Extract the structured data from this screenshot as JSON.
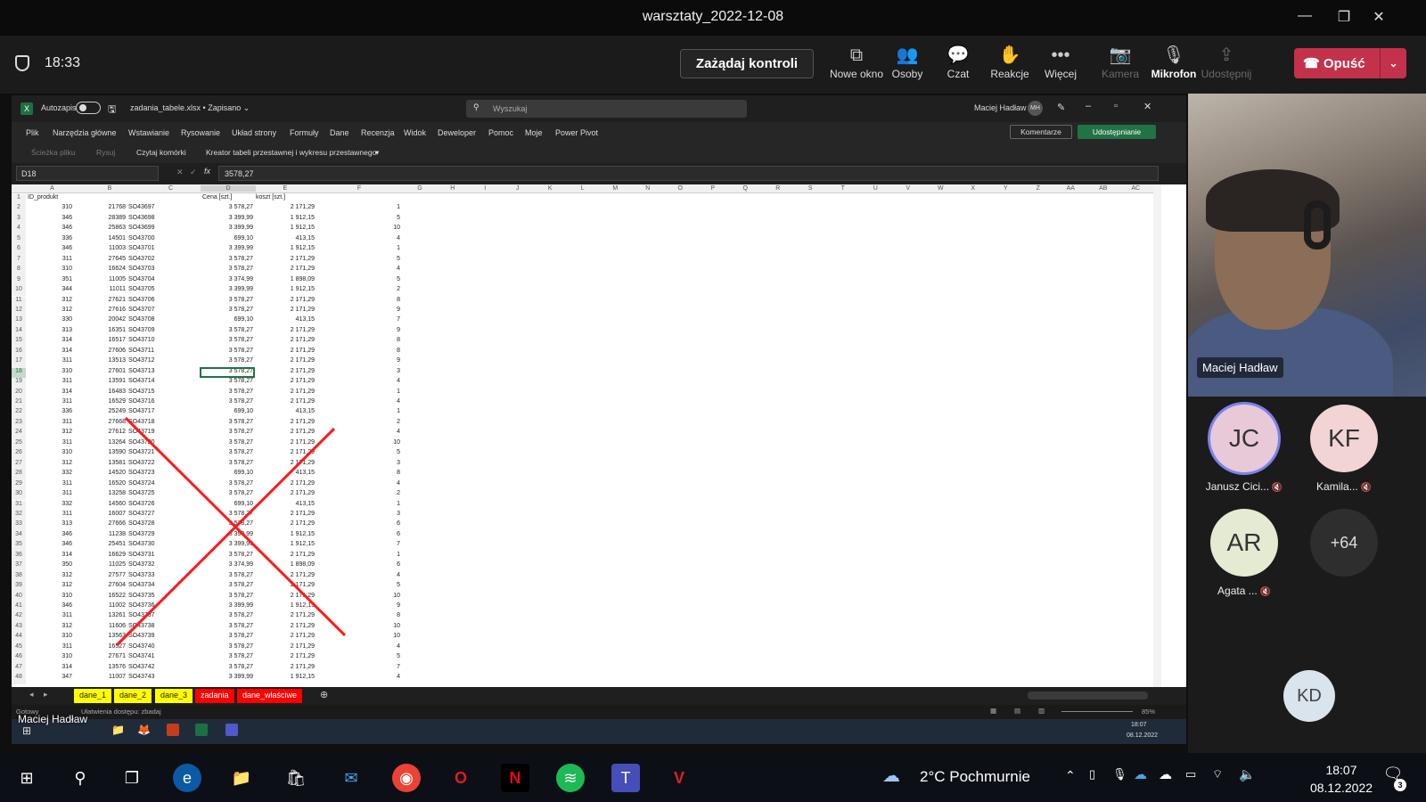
{
  "window": {
    "title": "warsztaty_2022-12-08"
  },
  "meeting": {
    "time": "18:33",
    "request_control": "Zażądaj kontroli",
    "tools": [
      {
        "label": "Nowe okno",
        "icon": "new-window-icon",
        "glyph": "⧉",
        "enabled": true
      },
      {
        "label": "Osoby",
        "icon": "people-icon",
        "glyph": "👥",
        "enabled": true
      },
      {
        "label": "Czat",
        "icon": "chat-icon",
        "glyph": "💬",
        "enabled": true
      },
      {
        "label": "Reakcje",
        "icon": "reactions-icon",
        "glyph": "✋",
        "enabled": true
      },
      {
        "label": "Więcej",
        "icon": "more-icon",
        "glyph": "•••",
        "enabled": true
      },
      {
        "label": "Kamera",
        "icon": "camera-off-icon",
        "glyph": "📷",
        "enabled": false
      },
      {
        "label": "Mikrofon",
        "icon": "mic-off-icon",
        "glyph": "🎙",
        "enabled": true
      },
      {
        "label": "Udostępnij",
        "icon": "share-icon",
        "glyph": "⇪",
        "enabled": false
      }
    ],
    "leave": "Opuść",
    "presenter_name": "Maciej Hadław"
  },
  "excel": {
    "autosave": "Autozapis",
    "filename": "zadania_tabele.xlsx • Zapisano ⌄",
    "search_placeholder": "Wyszukaj",
    "user": "Maciej Hadław",
    "user_initials": "MH",
    "menu": [
      "Plik",
      "Narzędzia główne",
      "Wstawianie",
      "Rysowanie",
      "Układ strony",
      "Formuły",
      "Dane",
      "Recenzja",
      "Widok",
      "Deweloper",
      "Pomoc",
      "Moje",
      "Power Pivot"
    ],
    "comments": "Komentarze",
    "share": "Udostępnianie",
    "toolbar": [
      "Ścieżka pliku",
      "Rysuj",
      "Czytaj komórki",
      "Kreator tabeli przestawnej i wykresu przestawnego"
    ],
    "namebox": "D18",
    "formula": "3578,27",
    "columns": [
      "A",
      "B",
      "C",
      "D",
      "E",
      "F",
      "G",
      "H",
      "I",
      "J",
      "K",
      "L",
      "M",
      "N",
      "O",
      "P",
      "Q",
      "R",
      "S",
      "T",
      "U",
      "V",
      "W",
      "X",
      "Y",
      "Z",
      "AA",
      "AB",
      "AC"
    ],
    "headers": {
      "a": "ID_produkt",
      "d": "Cena [szt.]",
      "e": "koszt [szt.]"
    },
    "rows": [
      [
        "310",
        "21768",
        "SO43697",
        "3 578,27",
        "2 171,29",
        "1"
      ],
      [
        "346",
        "28389",
        "SO43698",
        "3 399,99",
        "1 912,15",
        "5"
      ],
      [
        "346",
        "25863",
        "SO43699",
        "3 399,99",
        "1 912,15",
        "10"
      ],
      [
        "336",
        "14501",
        "SO43700",
        "699,10",
        "413,15",
        "4"
      ],
      [
        "346",
        "11003",
        "SO43701",
        "3 399,99",
        "1 912,15",
        "1"
      ],
      [
        "311",
        "27645",
        "SO43702",
        "3 578,27",
        "2 171,29",
        "5"
      ],
      [
        "310",
        "16624",
        "SO43703",
        "3 578,27",
        "2 171,29",
        "4"
      ],
      [
        "351",
        "11005",
        "SO43704",
        "3 374,99",
        "1 898,09",
        "5"
      ],
      [
        "344",
        "11011",
        "SO43705",
        "3 399,99",
        "1 912,15",
        "2"
      ],
      [
        "312",
        "27621",
        "SO43706",
        "3 578,27",
        "2 171,29",
        "8"
      ],
      [
        "312",
        "27616",
        "SO43707",
        "3 578,27",
        "2 171,29",
        "9"
      ],
      [
        "330",
        "20042",
        "SO43708",
        "699,10",
        "413,15",
        "7"
      ],
      [
        "313",
        "16351",
        "SO43709",
        "3 578,27",
        "2 171,29",
        "9"
      ],
      [
        "314",
        "16517",
        "SO43710",
        "3 578,27",
        "2 171,29",
        "8"
      ],
      [
        "314",
        "27606",
        "SO43711",
        "3 578,27",
        "2 171,29",
        "8"
      ],
      [
        "311",
        "13513",
        "SO43712",
        "3 578,27",
        "2 171,29",
        "9"
      ],
      [
        "310",
        "27601",
        "SO43713",
        "3 578,27",
        "2 171,29",
        "3"
      ],
      [
        "311",
        "13591",
        "SO43714",
        "3 578,27",
        "2 171,29",
        "4"
      ],
      [
        "314",
        "16483",
        "SO43715",
        "3 578,27",
        "2 171,29",
        "1"
      ],
      [
        "311",
        "16529",
        "SO43716",
        "3 578,27",
        "2 171,29",
        "4"
      ],
      [
        "336",
        "25249",
        "SO43717",
        "699,10",
        "413,15",
        "1"
      ],
      [
        "311",
        "27668",
        "SO43718",
        "3 578,27",
        "2 171,29",
        "2"
      ],
      [
        "312",
        "27612",
        "SO43719",
        "3 578,27",
        "2 171,29",
        "4"
      ],
      [
        "311",
        "13264",
        "SO43720",
        "3 578,27",
        "2 171,29",
        "10"
      ],
      [
        "310",
        "13590",
        "SO43721",
        "3 578,27",
        "2 171,29",
        "5"
      ],
      [
        "312",
        "13581",
        "SO43722",
        "3 578,27",
        "2 171,29",
        "3"
      ],
      [
        "332",
        "14520",
        "SO43723",
        "699,10",
        "413,15",
        "8"
      ],
      [
        "311",
        "16520",
        "SO43724",
        "3 578,27",
        "2 171,29",
        "4"
      ],
      [
        "311",
        "13258",
        "SO43725",
        "3 578,27",
        "2 171,29",
        "2"
      ],
      [
        "332",
        "14560",
        "SO43726",
        "699,10",
        "413,15",
        "1"
      ],
      [
        "311",
        "16007",
        "SO43727",
        "3 578,27",
        "2 171,29",
        "3"
      ],
      [
        "313",
        "27666",
        "SO43728",
        "3 578,27",
        "2 171,29",
        "6"
      ],
      [
        "346",
        "11238",
        "SO43729",
        "3 399,99",
        "1 912,15",
        "6"
      ],
      [
        "346",
        "25451",
        "SO43730",
        "3 399,99",
        "1 912,15",
        "7"
      ],
      [
        "314",
        "16629",
        "SO43731",
        "3 578,27",
        "2 171,29",
        "1"
      ],
      [
        "350",
        "11025",
        "SO43732",
        "3 374,99",
        "1 898,09",
        "6"
      ],
      [
        "312",
        "27577",
        "SO43733",
        "3 578,27",
        "2 171,29",
        "4"
      ],
      [
        "312",
        "27604",
        "SO43734",
        "3 578,27",
        "2 171,29",
        "5"
      ],
      [
        "310",
        "16522",
        "SO43735",
        "3 578,27",
        "2 171,29",
        "10"
      ],
      [
        "346",
        "11002",
        "SO43736",
        "3 399,99",
        "1 912,15",
        "9"
      ],
      [
        "311",
        "13261",
        "SO43737",
        "3 578,27",
        "2 171,29",
        "8"
      ],
      [
        "312",
        "11606",
        "SO43738",
        "3 578,27",
        "2 171,29",
        "10"
      ],
      [
        "310",
        "13563",
        "SO43739",
        "3 578,27",
        "2 171,29",
        "10"
      ],
      [
        "311",
        "16527",
        "SO43740",
        "3 578,27",
        "2 171,29",
        "4"
      ],
      [
        "310",
        "27671",
        "SO43741",
        "3 578,27",
        "2 171,29",
        "5"
      ],
      [
        "314",
        "13576",
        "SO43742",
        "3 578,27",
        "2 171,29",
        "7"
      ],
      [
        "347",
        "11007",
        "SO43743",
        "3 399,99",
        "1 912,15",
        "4"
      ]
    ],
    "sheets": [
      {
        "name": "dane_1",
        "color": "#ffff00"
      },
      {
        "name": "dane_2",
        "color": "#ffff00"
      },
      {
        "name": "dane_3",
        "color": "#ffff00"
      },
      {
        "name": "zadania",
        "color": "#ff0000"
      },
      {
        "name": "dane_właściwe",
        "color": "#ff0000"
      }
    ],
    "status": "Gotowy",
    "accessibility": "Ułatwienia dostępu: zbadaj",
    "zoom": "85%",
    "inner_time": "18:07",
    "inner_date": "08.12.2022"
  },
  "participants": {
    "video_name": "Maciej Hadław",
    "tiles": [
      {
        "initials": "JC",
        "name": "Janusz Cici...",
        "bg": "#e8c9d8",
        "ring": true
      },
      {
        "initials": "KF",
        "name": "Kamila...",
        "bg": "#f2d4d4",
        "ring": false
      },
      {
        "initials": "AR",
        "name": "Agata ...",
        "bg": "#e5ead3",
        "ring": false
      },
      {
        "initials": "+64",
        "name": "",
        "bg": "#2e2e2e",
        "ring": false
      }
    ],
    "bottom_initials": "KD"
  },
  "taskbar": {
    "weather": "2°C  Pochmurnie",
    "time": "18:07",
    "date": "08.12.2022",
    "notifications": "3"
  },
  "colors": {
    "teams_red": "#c4314b",
    "excel_green": "#217346",
    "annotation_red": "#ff1a1a"
  }
}
